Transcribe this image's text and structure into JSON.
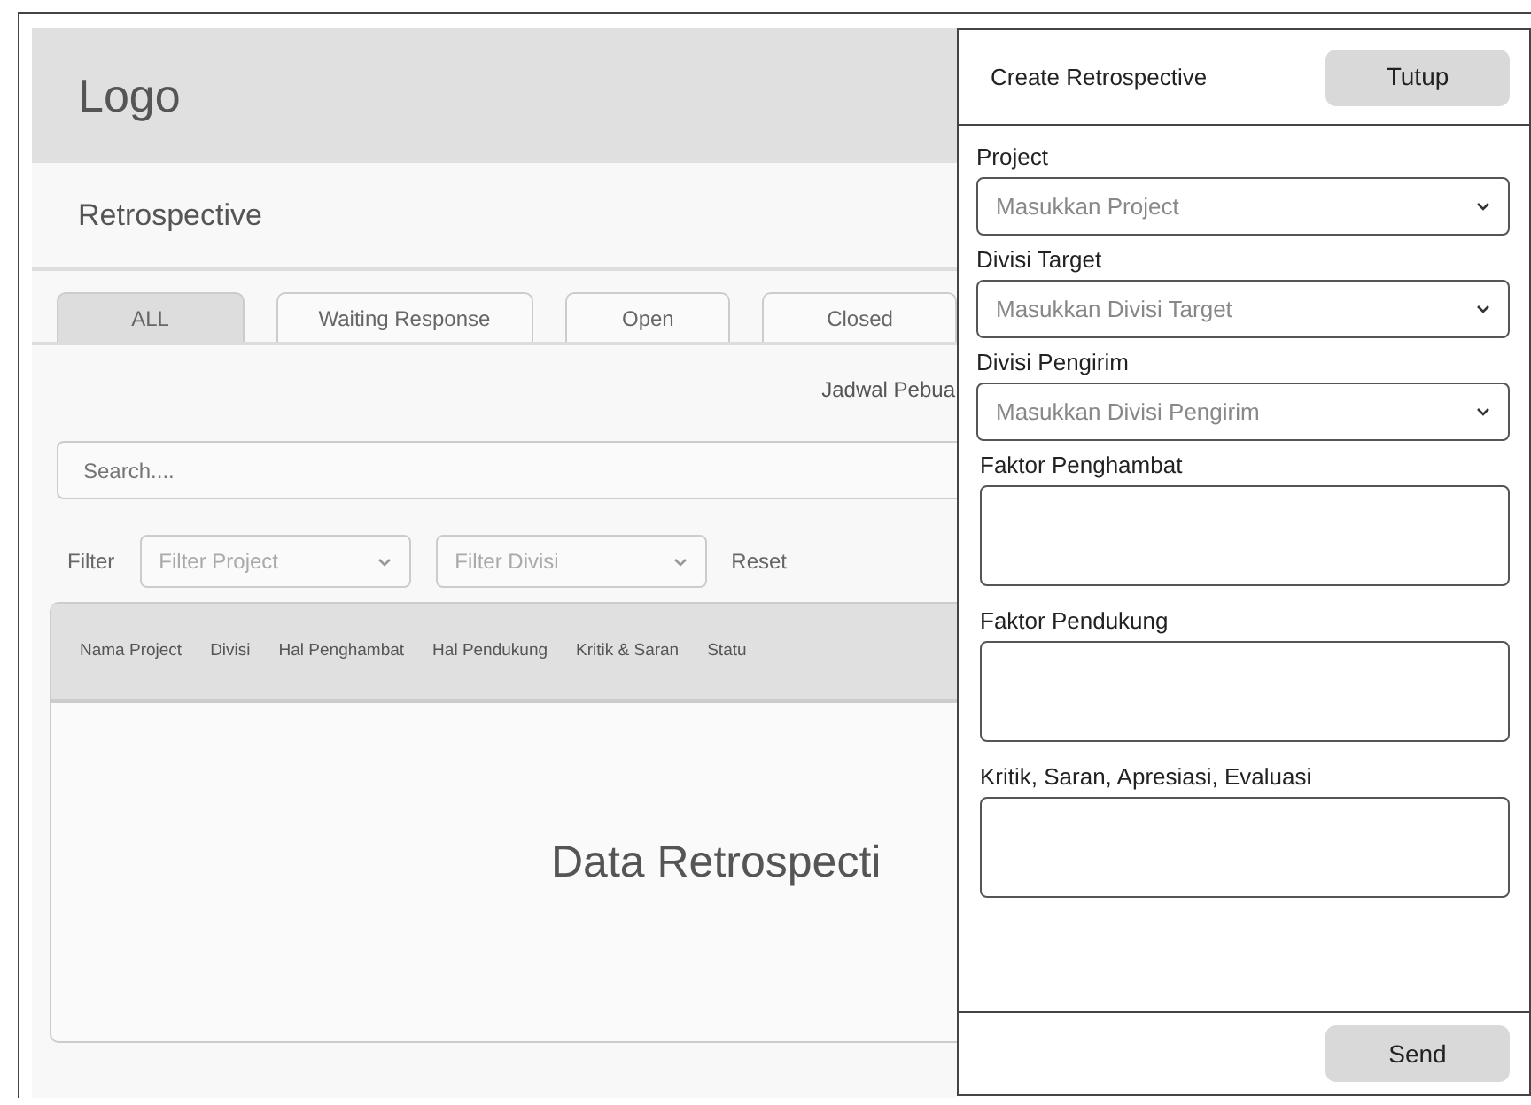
{
  "page": {
    "logo": "Logo",
    "title": "Retrospective",
    "tabs": [
      {
        "label": "ALL",
        "selected": true
      },
      {
        "label": "Waiting Response",
        "selected": false
      },
      {
        "label": "Open",
        "selected": false
      },
      {
        "label": "Closed",
        "selected": false
      }
    ],
    "schedule_text": "Jadwal Pebua",
    "search": {
      "placeholder": "Search...."
    },
    "filter": {
      "label": "Filter",
      "selects": [
        {
          "placeholder": "Filter Project"
        },
        {
          "placeholder": "Filter Divisi"
        }
      ],
      "reset": "Reset"
    },
    "table": {
      "columns": [
        "Nama Project",
        "Divisi",
        "Hal Penghambat",
        "Hal Pendukung",
        "Kritik & Saran",
        "Statu"
      ],
      "empty_text": "Data Retrospecti"
    }
  },
  "panel": {
    "title": "Create Retrospective",
    "close_button": "Tutup",
    "fields": [
      {
        "kind": "select",
        "label": "Project",
        "placeholder": "Masukkan Project"
      },
      {
        "kind": "select",
        "label": "Divisi Target",
        "placeholder": "Masukkan Divisi Target"
      },
      {
        "kind": "select",
        "label": "Divisi Pengirim",
        "placeholder": "Masukkan Divisi Pengirim"
      },
      {
        "kind": "textarea",
        "label": "Faktor Penghambat"
      },
      {
        "kind": "textarea",
        "label": "Faktor Pendukung"
      },
      {
        "kind": "textarea",
        "label": "Kritik, Saran, Apresiasi, Evaluasi"
      }
    ],
    "send_button": "Send"
  }
}
